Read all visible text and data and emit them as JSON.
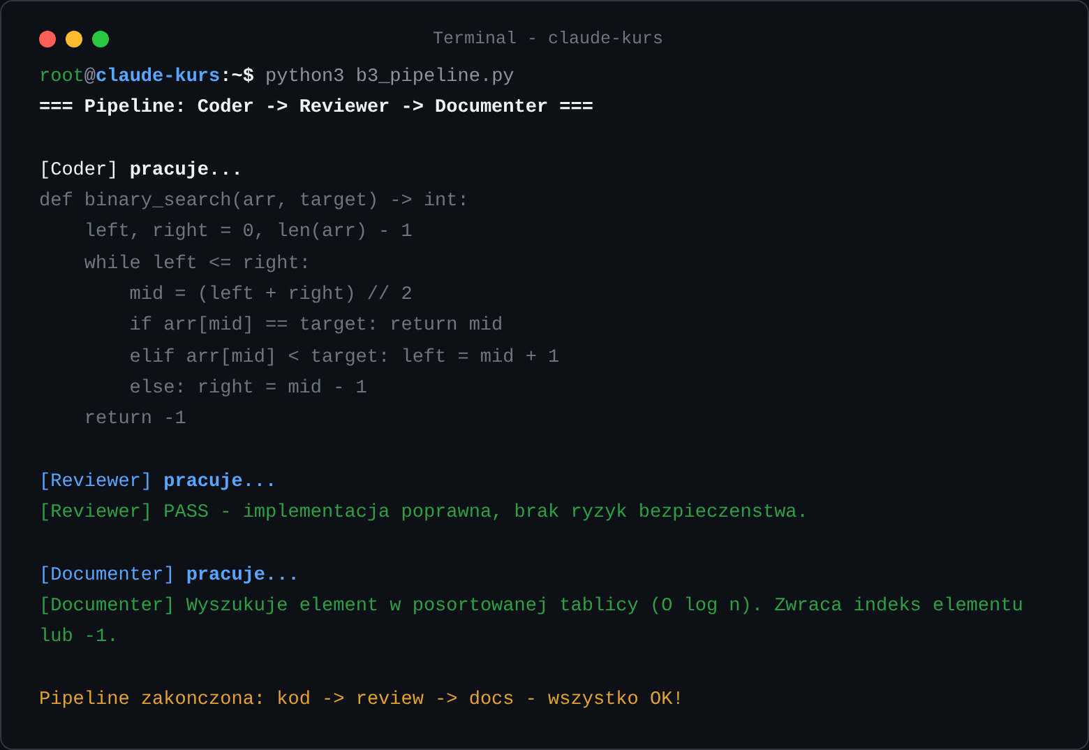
{
  "window": {
    "title": "Terminal - claude-kurs"
  },
  "blocks": [
    {
      "lines": [
        {
          "kind": "text",
          "segments": [
            {
              "text": "root",
              "color": "#2ea043",
              "bold": false
            },
            {
              "text": "@",
              "color": "#8b949e",
              "bold": false
            },
            {
              "text": "claude-kurs",
              "color": "#58a6ff",
              "bold": true
            },
            {
              "text": ":~$",
              "color": "#f0f3f6",
              "bold": true
            },
            {
              "text": " python3 b3_pipeline.py",
              "color": "#8b949e",
              "bold": false
            }
          ]
        },
        {
          "kind": "text",
          "segments": [
            {
              "text": "=== Pipeline: Coder -> Reviewer -> Documenter ===",
              "color": "#f0f3f6",
              "bold": true
            }
          ]
        }
      ]
    },
    {
      "lines": [
        {
          "kind": "text",
          "segments": [
            {
              "text": "[Coder]",
              "color": "#f0f3f6",
              "bold": false
            },
            {
              "text": " pracuje...",
              "color": "#f0f3f6",
              "bold": true
            }
          ]
        },
        {
          "kind": "code",
          "code": {
            "text": "def binary_search(arr, target) -> int:",
            "children": [
              {
                "text": "left, right = 0, len(arr) - 1"
              },
              {
                "text": "while left <= right:",
                "children": [
                  {
                    "text": "mid = (left + right) // 2"
                  },
                  {
                    "text": "if arr[mid] == target: return mid"
                  },
                  {
                    "text": "elif arr[mid] < target: left = mid + 1"
                  },
                  {
                    "text": "else: right = mid - 1"
                  }
                ]
              },
              {
                "text": "return -1"
              }
            ]
          }
        }
      ]
    },
    {
      "lines": [
        {
          "kind": "text",
          "segments": [
            {
              "text": "[Reviewer]",
              "color": "#58a6ff",
              "bold": false
            },
            {
              "text": " pracuje...",
              "color": "#58a6ff",
              "bold": true
            }
          ]
        },
        {
          "kind": "text",
          "segments": [
            {
              "text": "[Reviewer] PASS - implementacja poprawna, brak ryzyk bezpieczenstwa.",
              "color": "#2ea043",
              "bold": false
            }
          ]
        }
      ]
    },
    {
      "lines": [
        {
          "kind": "text",
          "segments": [
            {
              "text": "[Documenter]",
              "color": "#58a6ff",
              "bold": false
            },
            {
              "text": " pracuje...",
              "color": "#58a6ff",
              "bold": true
            }
          ]
        },
        {
          "kind": "text",
          "segments": [
            {
              "text": "[Documenter] Wyszukuje element w posortowanej tablicy (O log n). Zwraca indeks elementu lub -1.",
              "color": "#2ea043",
              "bold": false
            }
          ]
        }
      ]
    },
    {
      "lines": [
        {
          "kind": "text",
          "segments": [
            {
              "text": "Pipeline zakonczona: kod -> review -> docs - wszystko OK!",
              "color": "#e3a130",
              "bold": false
            }
          ]
        }
      ]
    }
  ]
}
